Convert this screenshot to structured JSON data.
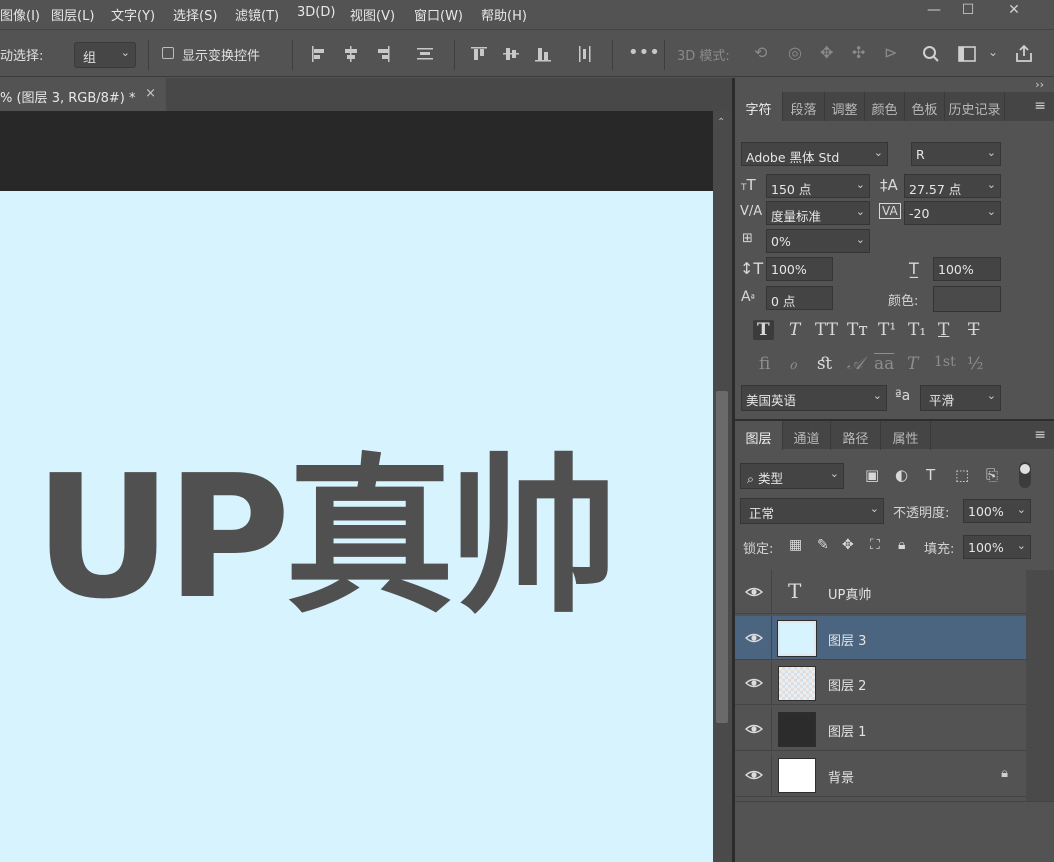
{
  "menu": [
    "图像(I)",
    "图层(L)",
    "文字(Y)",
    "选择(S)",
    "滤镜(T)",
    "3D(D)",
    "视图(V)",
    "窗口(W)",
    "帮助(H)"
  ],
  "window_controls": {
    "minimize": "—",
    "maximize": "☐",
    "close": "✕"
  },
  "options": {
    "auto_select_label": "动选择:",
    "auto_select_value": "组",
    "show_transform_label": "显示变换控件",
    "mode_3d_label": "3D 模式:"
  },
  "document": {
    "tab_title": "% (图层 3, RGB/8#) *",
    "tab_close": "×",
    "canvas_text": "UP真帅",
    "canvas_bg": "#d7f3fe",
    "text_color": "#505050"
  },
  "char_panel": {
    "tabs": [
      "字符",
      "段落",
      "调整",
      "颜色",
      "色板",
      "历史记录"
    ],
    "font_family": "Adobe 黑体 Std",
    "font_style": "R",
    "font_size": "150 点",
    "leading": "27.57 点",
    "kerning": "度量标准",
    "tracking": "-20",
    "tsume": "0%",
    "vertical_scale": "100%",
    "horizontal_scale": "100%",
    "baseline_shift": "0 点",
    "color_label": "颜色:",
    "language": "美国英语",
    "aa_icon": "ªa",
    "antialias": "平滑",
    "style_glyphs": [
      "T",
      "T",
      "TT",
      "Tт",
      "T¹",
      "T₁",
      "T",
      "T"
    ],
    "opentype_glyphs": [
      "ﬁ",
      "ℴ",
      "ﬆ",
      "𝒜",
      "aa",
      "T",
      "1st",
      "½"
    ]
  },
  "layers_panel": {
    "tabs": [
      "图层",
      "通道",
      "路径",
      "属性"
    ],
    "filter_label": "类型",
    "blend_mode": "正常",
    "opacity_label": "不透明度:",
    "opacity": "100%",
    "lock_label": "锁定:",
    "fill_label": "填充:",
    "fill": "100%",
    "layers": [
      {
        "name": "UP真帅",
        "kind": "text"
      },
      {
        "name": "图层 3",
        "kind": "solid",
        "selected": true
      },
      {
        "name": "图层 2",
        "kind": "transparent"
      },
      {
        "name": "图层 1",
        "kind": "dark"
      },
      {
        "name": "背景",
        "kind": "white",
        "locked": true
      }
    ]
  }
}
